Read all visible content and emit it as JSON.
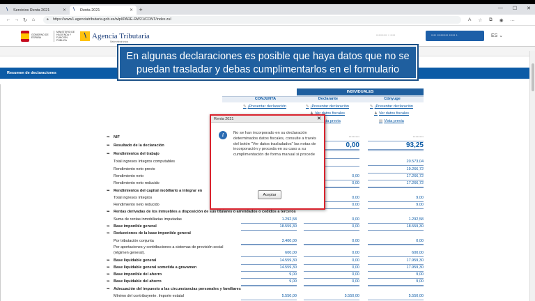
{
  "browser": {
    "tabs": [
      {
        "label": "Servicios Renta 2021",
        "active": false
      },
      {
        "label": "Renta 2021",
        "active": true
      }
    ],
    "url": "https://www1.agenciatributaria.gob.es/wlpl/PARE-RW21/CONT/index.zul"
  },
  "site": {
    "gob_label": "GOBIERNO DE ESPAÑA",
    "ministry_label": "MINISTERIO DE HACIENDA Y FUNCIÓN PÚBLICA",
    "brand": "Agencia Tributaria",
    "brand_sub": "Sede electrónica",
    "user_line": "••••••••• • ••••",
    "user_button": "•••• ••••••••• ••••• •.",
    "lang": "ES"
  },
  "callout": {
    "line1": "En algunas declaraciones es posible que haya datos que no se",
    "line2": "puedan trasladar y debas cumplimentarlos en el formulario"
  },
  "section": {
    "title": "Resumen de declaraciones"
  },
  "columns": {
    "individuales": "INDIVIDUALES",
    "conjunta": "CONJUNTA",
    "declarante": "Declarante",
    "conyuge": "Cónyuge"
  },
  "links": {
    "presentar": "¡Presentar declaración",
    "ver_datos": "Ver datos fiscales",
    "vista_previa": "Vista previa"
  },
  "rows": [
    {
      "label": "NIF",
      "bold": true,
      "arrow": true,
      "v1": "",
      "v2": "••••••••",
      "v3": "••••••••",
      "blur": true
    },
    {
      "label": "Resultado de la declaración",
      "bold": true,
      "arrow": true,
      "v1": "",
      "v2": "0,00",
      "v3": "93,25",
      "big": true
    },
    {
      "label": "Rendimientos del trabajo",
      "bold": true,
      "arrow": true,
      "v1": "",
      "v2": "",
      "v3": ""
    },
    {
      "label": "Total ingresos íntegros computables",
      "v1": "",
      "v2": "",
      "v3": "20.573,04"
    },
    {
      "label": "Rendimiento neto previo",
      "v1": "",
      "v2": "",
      "v3": "19.266,72"
    },
    {
      "label": "Rendimiento neto",
      "v1": "",
      "v2": "0,00",
      "v3": "17.266,72"
    },
    {
      "label": "Rendimiento neto reducido",
      "v1": "",
      "v2": "0,00",
      "v3": "17.266,72"
    },
    {
      "label": "Rendimientos del capital mobiliario a integrar en",
      "bold": true,
      "arrow": true,
      "v1": "",
      "v2": "",
      "v3": ""
    },
    {
      "label": "Total ingresos íntegros",
      "v1": "",
      "v2": "0,00",
      "v3": "9,00"
    },
    {
      "label": "Rendimiento neto reducido",
      "v1": "",
      "v2": "0,00",
      "v3": "9,00"
    },
    {
      "label": "Rentas derivadas de los inmuebles a disposición de sus titulares o arrendados o cedidos a terceros",
      "bold": true,
      "arrow": true,
      "v1": "",
      "v2": "",
      "v3": ""
    },
    {
      "label": "Suma de rentas inmobiliarias imputadas",
      "v1": "1.292,58",
      "v2": "0,00",
      "v3": "1.292,58"
    },
    {
      "label": "Base imponible general",
      "bold": true,
      "arrow": true,
      "v1": "18.559,30",
      "v2": "0,00",
      "v3": "18.559,30"
    },
    {
      "label": "Reducciones de la base imponible general",
      "bold": true,
      "arrow": true,
      "v1": "",
      "v2": "",
      "v3": ""
    },
    {
      "label": "Por tributación conjunta",
      "v1": "3.400,00",
      "v2": "0,00",
      "v3": "0,00"
    },
    {
      "label": "Por aportaciones y contribuciones a sistemas de previsión social",
      "v1": "",
      "v2": "",
      "v3": ""
    },
    {
      "label": "(régimen general).",
      "v1": "600,00",
      "v2": "0,00",
      "v3": "600,00"
    },
    {
      "label": "Base liquidable general",
      "bold": true,
      "arrow": true,
      "v1": "14.559,30",
      "v2": "0,00",
      "v3": "17.959,30"
    },
    {
      "label": "Base liquidable general sometida a gravamen",
      "bold": true,
      "arrow": true,
      "v1": "14.559,30",
      "v2": "0,00",
      "v3": "17.959,30"
    },
    {
      "label": "Base imponible del ahorro",
      "bold": true,
      "arrow": true,
      "v1": "9,00",
      "v2": "0,00",
      "v3": "9,00"
    },
    {
      "label": "Base liquidable del ahorro",
      "bold": true,
      "arrow": true,
      "v1": "9,00",
      "v2": "0,00",
      "v3": "9,00"
    },
    {
      "label": "Adecuación del impuesto a las circunstancias personales y familiares",
      "bold": true,
      "arrow": true,
      "v1": "",
      "v2": "",
      "v3": ""
    },
    {
      "label": "Mínimo del contribuyente. Importe estatal",
      "v1": "5.550,00",
      "v2": "5.550,00",
      "v3": "5.550,00"
    }
  ],
  "modal": {
    "title": "Renta 2021",
    "message": "No se han incorporado en su declaración determinados datos fiscales, consulte a través del botón \"Ver datos trasladados\" las notas de incorporación y proceda en su caso a su cumplimentación de forma manual si procede",
    "button": "Aceptar"
  }
}
